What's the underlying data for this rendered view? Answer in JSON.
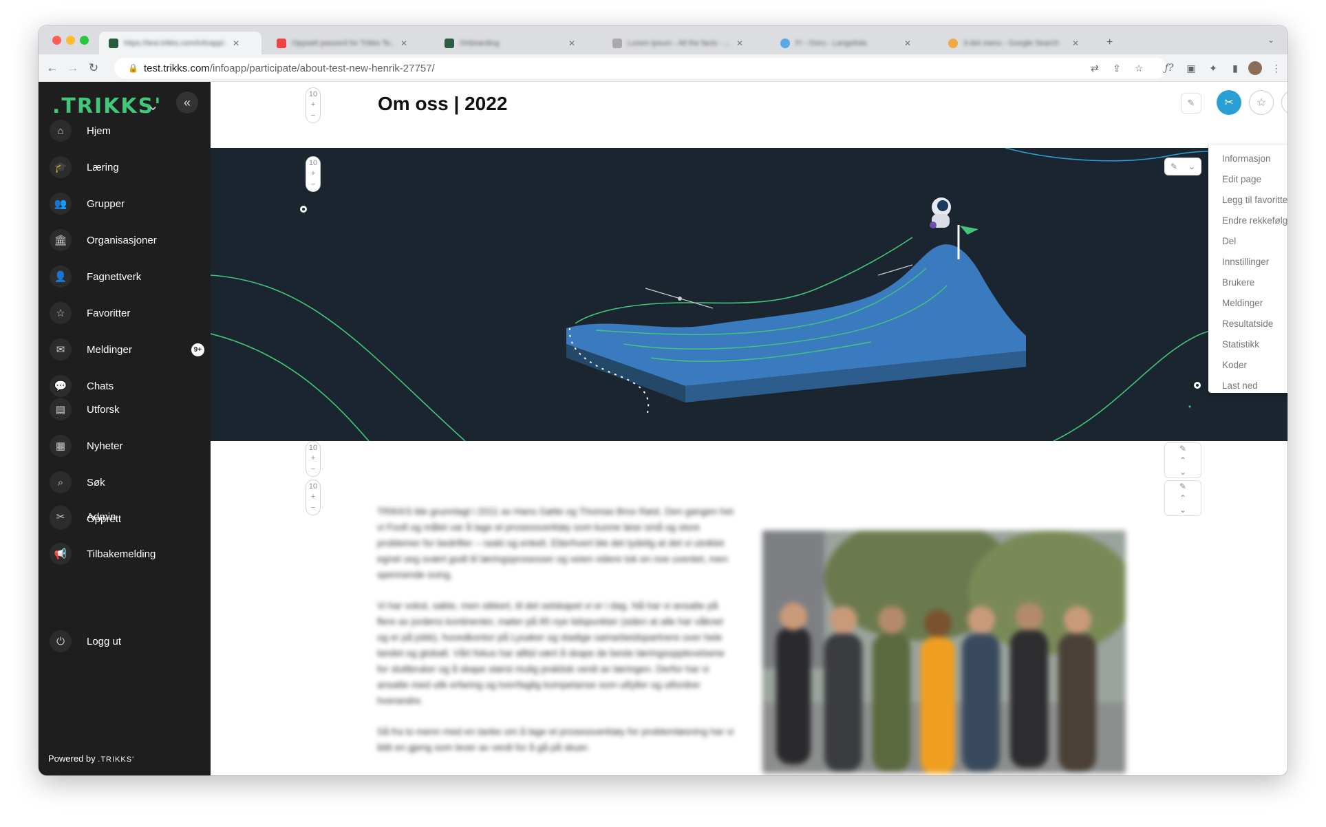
{
  "browser": {
    "tabs": [
      {
        "title": "https://test.trikks.com/infoapp/..."
      },
      {
        "title": "Oppsett passord for Trikks Te..."
      },
      {
        "title": "Onboarding"
      },
      {
        "title": "Lorem Ipsum - All the facts - ..."
      },
      {
        "title": "Fr - Doru - Langeliste"
      },
      {
        "title": "3-dot menu - Google Search"
      }
    ],
    "url": "test.trikks.com/infoapp/participate/about-test-new-henrik-27757/",
    "url_domain": "test.trikks.com",
    "url_path": "/infoapp/participate/about-test-new-henrik-27757/"
  },
  "sidebar": {
    "logo": ".TRIKKS'",
    "items_top": [
      {
        "label": "Hjem",
        "icon": "home-icon",
        "glyph": "⌂"
      },
      {
        "label": "Læring",
        "icon": "graduation-cap-icon",
        "glyph": "🎓"
      },
      {
        "label": "Grupper",
        "icon": "group-icon",
        "glyph": "👥"
      },
      {
        "label": "Organisasjoner",
        "icon": "institution-icon",
        "glyph": "🏛"
      },
      {
        "label": "Fagnettverk",
        "icon": "network-icon",
        "glyph": "👤"
      },
      {
        "label": "Favoritter",
        "icon": "star-icon",
        "glyph": "☆"
      },
      {
        "label": "Meldinger",
        "icon": "mail-icon",
        "glyph": "✉",
        "badge": "9+"
      },
      {
        "label": "Chats",
        "icon": "chat-icon",
        "glyph": "💬"
      }
    ],
    "items_mid": [
      {
        "label": "Utforsk",
        "icon": "explore-icon",
        "glyph": "▤"
      },
      {
        "label": "Nyheter",
        "icon": "news-icon",
        "glyph": "▦"
      },
      {
        "label": "Søk",
        "icon": "search-icon",
        "glyph": "⌕"
      },
      {
        "label": "Opprett",
        "icon": "plus-icon",
        "glyph": "+"
      }
    ],
    "items_bottom": [
      {
        "label": "Admin",
        "icon": "tools-icon",
        "glyph": "✂"
      },
      {
        "label": "Tilbakemelding",
        "icon": "megaphone-icon",
        "glyph": "📢"
      }
    ],
    "logout": {
      "label": "Logg ut",
      "icon": "power-icon",
      "glyph": "⏻"
    },
    "powered_by": "Powered by",
    "powered_brand": ".TRIKKS'"
  },
  "page": {
    "title": "Om oss | 2022",
    "stepper_value": "10",
    "stepper_plus": "+",
    "stepper_minus": "−",
    "paragraphs": [
      "TRIKKS ble grunnlagt i 2011 av Hans Gøtte og Thomas Brox Røst. Den gangen het vi Fooll og målet var å lage et prosessverktøy som kunne løse små og store problemer for bedrifter – raskt og enkelt. Etterhvert ble det tydelig at det vi utviklet egnet seg svært godt til læringsprosesser og veien videre tok en noe uventet, men spennende sving.",
      "Vi har vokst, sakte, men sikkert, til det selskapet vi er i dag. Nå har vi ansatte på flere av jordens kontinenter, møter på 85 nye tidspunkter (siden at alle har våknet og er på jobb), hovedkontor på Lysaker og stadige samarbeidspartnere over hele landet og globalt. Vårt fokus har alltid vært å skape de beste læringsopplevelsene for sluttbruker og å skape størst mulig praktisk verdi av læringen. Derfor har vi ansatte med ulik erfaring og tverrfaglig kompetanse som utfyller og utfordrer hverandre.",
      "Så fra to menn med en tanke om å lage et prosessverktøy for problemløsning har vi blitt en gjeng som lever av verdi for å gå på skuer."
    ]
  },
  "dropdown": {
    "items": [
      "Informasjon",
      "Edit page",
      "Legg til favoritter",
      "Endre rekkefølge",
      "Del",
      "Innstillinger",
      "Brukere",
      "Meldinger",
      "Resultatside",
      "Statistikk",
      "Koder",
      "Last ned"
    ]
  },
  "colors": {
    "sidebar_bg": "#1e1e1e",
    "brand_green": "#42c67a",
    "accent_blue": "#2a9fd6",
    "hero_bg": "#1b2530"
  }
}
